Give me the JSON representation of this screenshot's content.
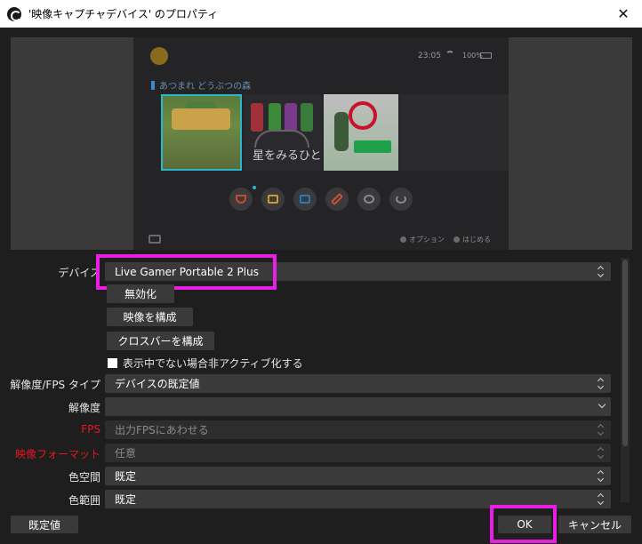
{
  "window": {
    "title": "'映像キャプチャデバイス' のプロパティ",
    "close_symbol": "✕"
  },
  "preview": {
    "time": "23:05",
    "battery": "100%",
    "game_title": "あつまれ どうぶつの森",
    "tile2_text": "星をみるひと",
    "hints": [
      "オプション",
      "はじめる"
    ]
  },
  "form": {
    "device_label": "デバイス",
    "device_value": "Live Gamer Portable 2 Plus",
    "disable_button": "無効化",
    "configure_video_button": "映像を構成",
    "configure_crossbar_button": "クロスバーを構成",
    "deactivate_checkbox": "表示中でない場合非アクティブ化する",
    "resolution_fps_type_label": "解像度/FPS タイプ",
    "resolution_fps_type_value": "デバイスの既定値",
    "resolution_label": "解像度",
    "resolution_value": "",
    "fps_label": "FPS",
    "fps_value": "出力FPSにあわせる",
    "video_format_label": "映像フォーマット",
    "video_format_value": "任意",
    "color_space_label": "色空間",
    "color_space_value": "既定",
    "color_range_label": "色範囲",
    "color_range_value": "既定"
  },
  "footer": {
    "defaults_button": "既定値",
    "ok_button": "OK",
    "cancel_button": "キャンセル"
  },
  "colors": {
    "highlight": "#e81ee3",
    "warning_label": "#e5161c",
    "background": "#1f1e1f",
    "control": "#3b3a3b"
  }
}
